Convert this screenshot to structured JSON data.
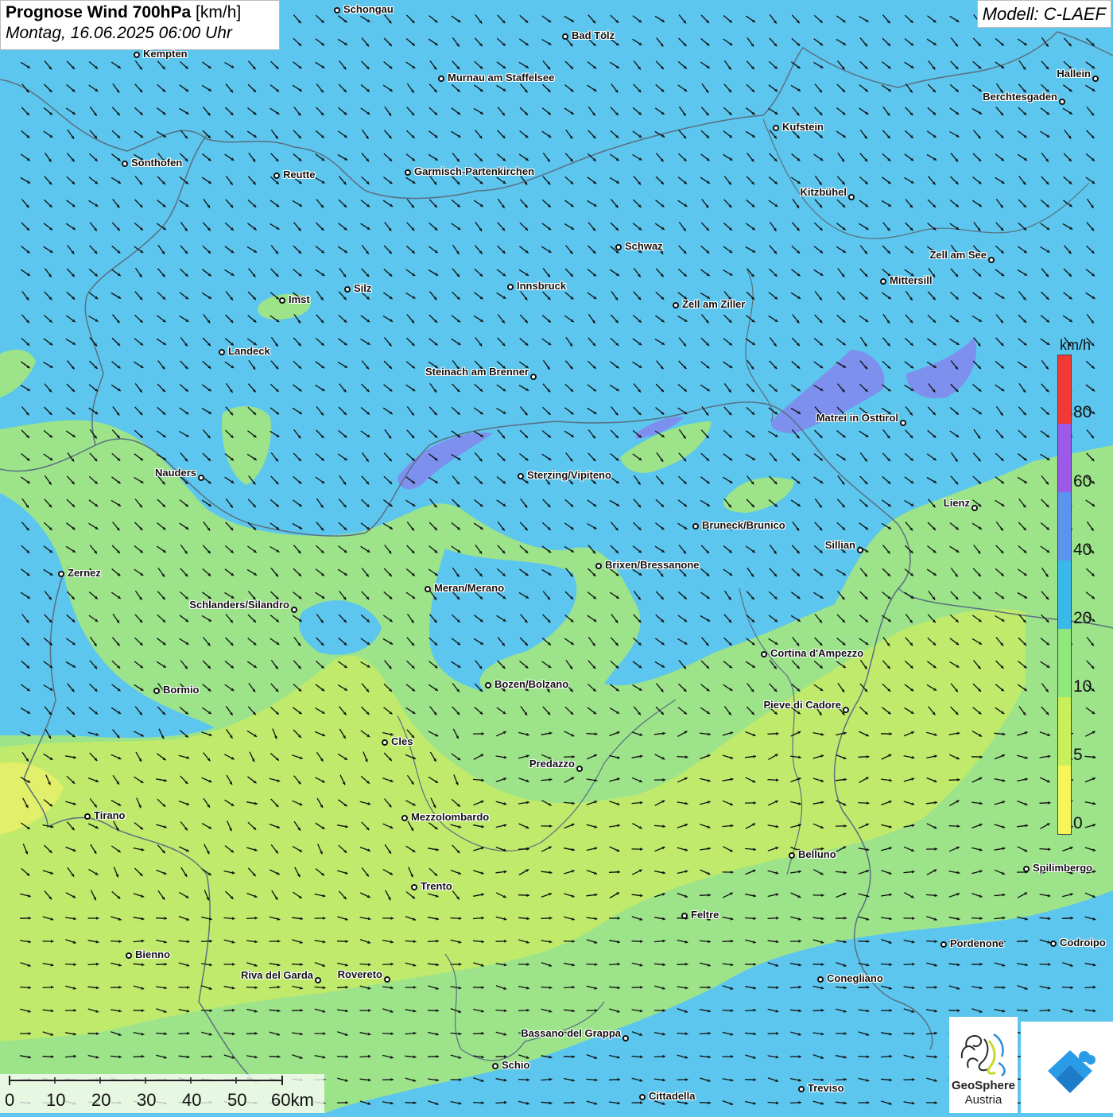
{
  "title": {
    "main": "Prognose Wind 700hPa",
    "unit": "[km/h]",
    "datetime": "Montag, 16.06.2025 06:00 Uhr"
  },
  "model": "Modell: C-LAEF",
  "legend": {
    "unit": "km/h",
    "labels": [
      "80",
      "60",
      "40",
      "20",
      "10",
      "5",
      "0"
    ],
    "colors": [
      "#f23a35",
      "#9c5ae8",
      "#5b93ee",
      "#3bb8ea",
      "#8ee87c",
      "#c8f05a",
      "#f7f55a"
    ]
  },
  "scalebar": {
    "labels": [
      "0",
      "10",
      "20",
      "30",
      "40",
      "50",
      "60km"
    ]
  },
  "logo": {
    "name": "GeoSphere",
    "sub": "Austria"
  },
  "colors": {
    "wind_low": "#f2f070",
    "wind_5": "#c2ea6a",
    "wind_10": "#9ce38a",
    "wind_20": "#5cc6ee",
    "wind_40": "#7d90ee"
  },
  "cities": [
    {
      "name": "Schongau"
    },
    {
      "name": "Bad Tölz"
    },
    {
      "name": "Kempten"
    },
    {
      "name": "Murnau am Staffelsee"
    },
    {
      "name": "Hallein"
    },
    {
      "name": "Berchtesgaden"
    },
    {
      "name": "Kufstein"
    },
    {
      "name": "Sonthofen"
    },
    {
      "name": "Reutte"
    },
    {
      "name": "Garmisch-Partenkirchen"
    },
    {
      "name": "Kitzbühel"
    },
    {
      "name": "Schwaz"
    },
    {
      "name": "Zell am See"
    },
    {
      "name": "Mittersill"
    },
    {
      "name": "Innsbruck"
    },
    {
      "name": "Silz"
    },
    {
      "name": "Imst"
    },
    {
      "name": "Zell am Ziller"
    },
    {
      "name": "Landeck"
    },
    {
      "name": "Steinach am Brenner"
    },
    {
      "name": "Matrei in Osttirol"
    },
    {
      "name": "Nauders"
    },
    {
      "name": "Sterzing/Vipiteno"
    },
    {
      "name": "Lienz"
    },
    {
      "name": "Bruneck/Brunico"
    },
    {
      "name": "Sillian"
    },
    {
      "name": "Brixen/Bressanone"
    },
    {
      "name": "Zernez"
    },
    {
      "name": "Meran/Merano"
    },
    {
      "name": "Schlanders/Silandro"
    },
    {
      "name": "Cortina d'Ampezzo"
    },
    {
      "name": "Bozen/Bolzano"
    },
    {
      "name": "Bormio"
    },
    {
      "name": "Pieve di Cadore"
    },
    {
      "name": "Cles"
    },
    {
      "name": "Predazzo"
    },
    {
      "name": "Tirano"
    },
    {
      "name": "Mezzolombardo"
    },
    {
      "name": "Belluno"
    },
    {
      "name": "Spilimbergo"
    },
    {
      "name": "Trento"
    },
    {
      "name": "Feltre"
    },
    {
      "name": "Bienno"
    },
    {
      "name": "Pordenone"
    },
    {
      "name": "Codroipo"
    },
    {
      "name": "Riva del Garda"
    },
    {
      "name": "Rovereto"
    },
    {
      "name": "Conegliano"
    },
    {
      "name": "Bassano del Grappa"
    },
    {
      "name": "Schio"
    },
    {
      "name": "Treviso"
    },
    {
      "name": "Cittadella"
    }
  ]
}
